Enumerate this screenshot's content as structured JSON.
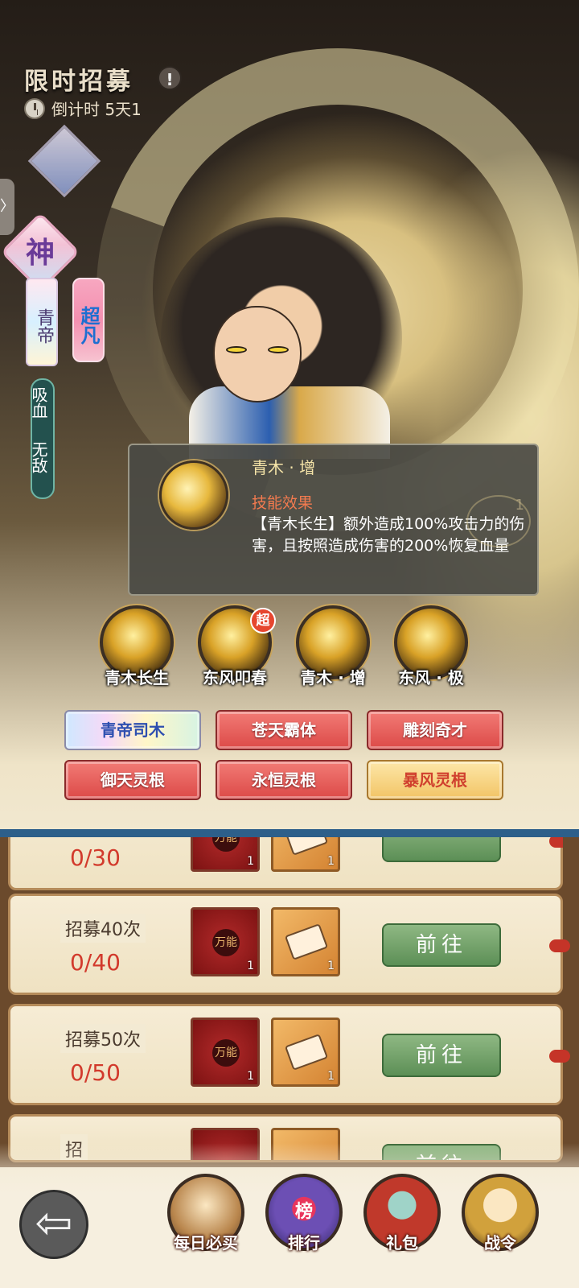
{
  "header": {
    "title": "限时招募",
    "info_icon": "!",
    "countdown": "倒计时 5天1"
  },
  "hero": {
    "tier": "神",
    "name": "青帝",
    "rank": "超凡",
    "traits": [
      "吸血",
      "无敌"
    ]
  },
  "tooltip": {
    "skill_name": "青木 · 增",
    "heading": "技能效果",
    "description": "【青木长生】额外造成100%攻击力的伤害，且按照造成伤害的200%恢复血量",
    "faint_badge": "1"
  },
  "skills": [
    {
      "label": "青木长生"
    },
    {
      "label": "东风叩春",
      "badge": "超"
    },
    {
      "label": "青木 · 增"
    },
    {
      "label": "东风 · 极"
    }
  ],
  "trait_buttons": [
    "青帝司木",
    "苍天霸体",
    "雕刻奇才",
    "御天灵根",
    "永恒灵根",
    "暴风灵根"
  ],
  "tasks": [
    {
      "title": "",
      "progress": "0/30",
      "button": ""
    },
    {
      "title": "招募40次",
      "progress": "0/40",
      "button": "前往"
    },
    {
      "title": "招募50次",
      "progress": "0/50",
      "button": "前往"
    },
    {
      "title": "招",
      "progress": "",
      "button": "前往"
    }
  ],
  "rewards": {
    "red_icon_text": "万能",
    "quantity": "1"
  },
  "bottom_nav": [
    {
      "label": "每日必买",
      "icon": "daily-deal-icon"
    },
    {
      "label": "排行",
      "icon": "ranking-icon",
      "sub": "榜"
    },
    {
      "label": "礼包",
      "icon": "gift-bag-icon"
    },
    {
      "label": "战令",
      "icon": "battle-pass-icon"
    }
  ],
  "back_icon": "⇦",
  "side_tab_icon": "〉",
  "colors": {
    "tooltip_bg": "#4a4a44",
    "red_button": "#dc4a48",
    "go_button": "#5c8f56",
    "progress_red": "#d23a2c"
  }
}
